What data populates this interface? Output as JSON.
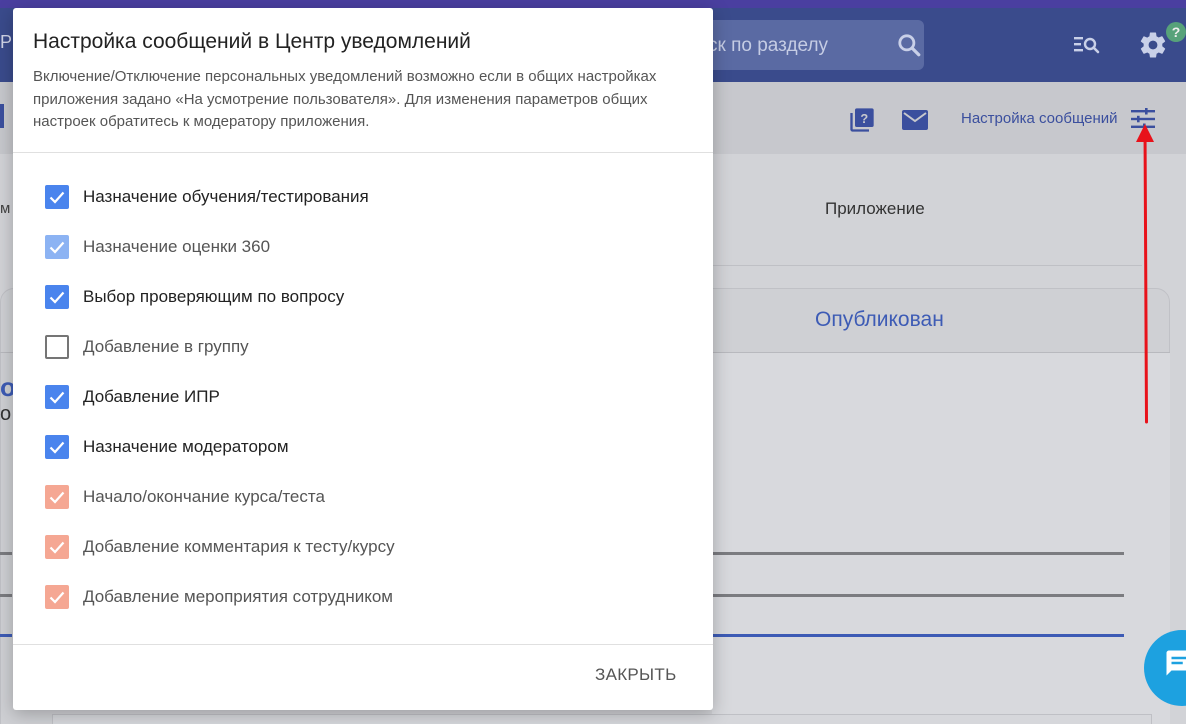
{
  "background": {
    "search_placeholder": "ск по разделу",
    "left_stub_top": "Р",
    "settings_link": "Настройка сообщений",
    "column_header": "Приложение",
    "left_stub_letter": "м",
    "card_tab": "Опубликован",
    "left_stub_blue": "о",
    "left_stub_dark": "о",
    "help_badge": "?"
  },
  "modal": {
    "title": "Настройка сообщений в Центр уведомлений",
    "description": "Включение/Отключение персональных уведомлений возможно если в общих настройках приложения задано «На усмотрение пользователя». Для изменения параметров общих настроек обратитесь к модератору приложения.",
    "options": [
      {
        "label": "Назначение обучения/тестирования",
        "checked": true,
        "state": "enabled"
      },
      {
        "label": "Назначение оценки 360",
        "checked": true,
        "state": "disabled"
      },
      {
        "label": "Выбор проверяющим по вопросу",
        "checked": true,
        "state": "enabled"
      },
      {
        "label": "Добавление в группу",
        "checked": false,
        "state": "enabled"
      },
      {
        "label": "Добавление ИПР",
        "checked": true,
        "state": "enabled"
      },
      {
        "label": "Назначение модератором",
        "checked": true,
        "state": "enabled"
      },
      {
        "label": "Начало/окончание курса/теста",
        "checked": true,
        "state": "locked"
      },
      {
        "label": "Добавление комментария к тесту/курсу",
        "checked": true,
        "state": "locked"
      },
      {
        "label": "Добавление мероприятия сотрудником",
        "checked": true,
        "state": "locked"
      }
    ],
    "close_label": "ЗАКРЫТЬ"
  },
  "colors": {
    "checkbox_enabled": "#4a84ed",
    "checkbox_disabled": "#8cb3f3",
    "checkbox_locked": "#f5a793",
    "topbar": "#3a4b8c",
    "annotation_arrow": "#e8121b"
  }
}
